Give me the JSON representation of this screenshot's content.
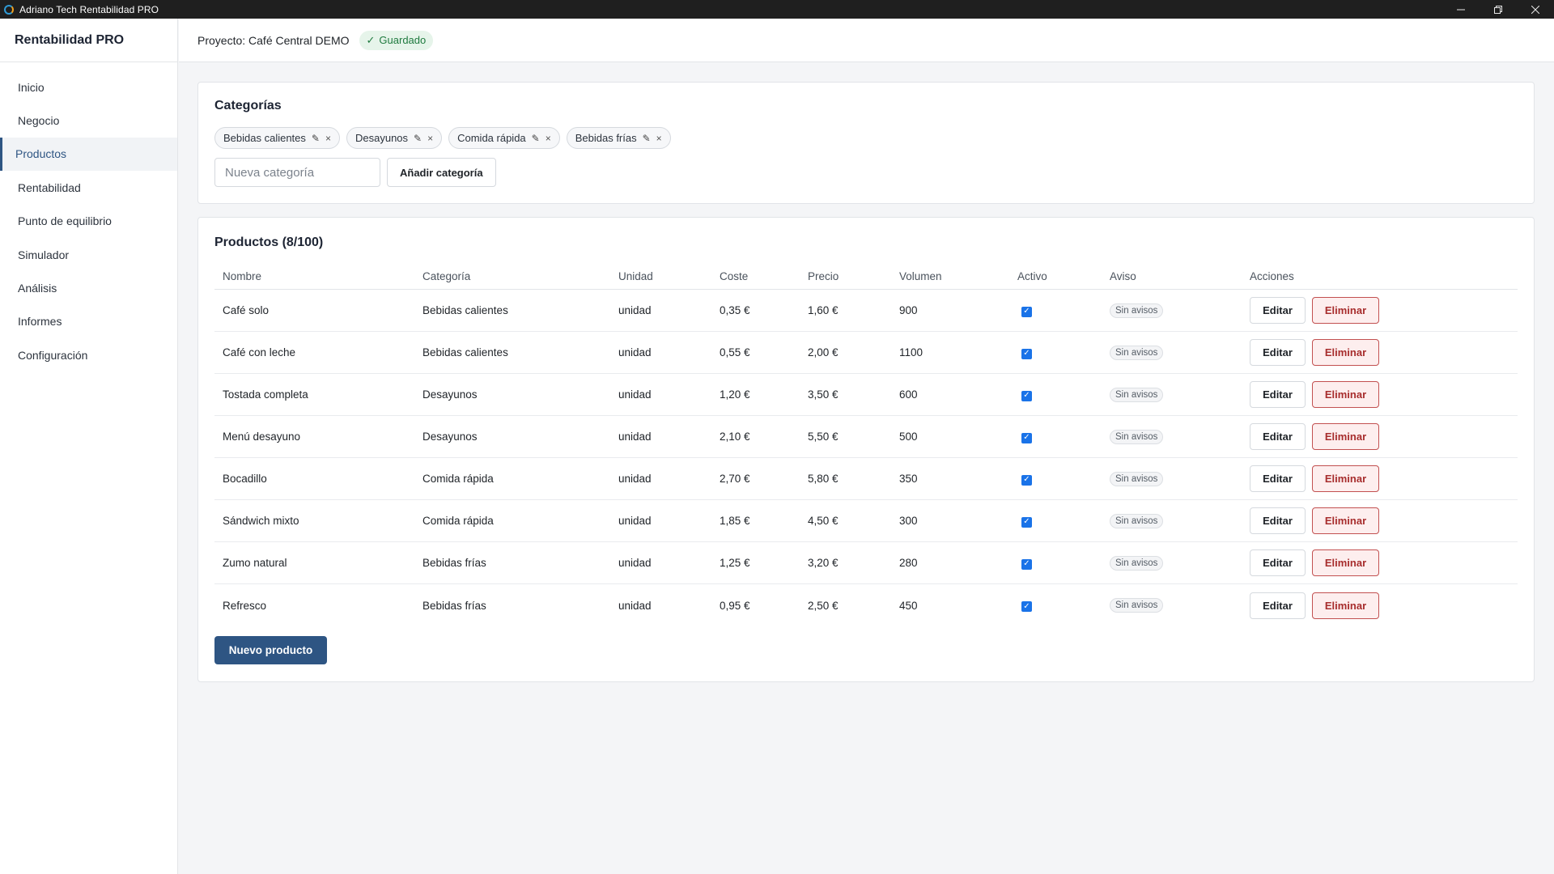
{
  "window": {
    "title": "Adriano Tech Rentabilidad PRO",
    "controls": [
      "minimize-icon",
      "restore-icon",
      "close-icon"
    ]
  },
  "sidebar": {
    "brand": "Rentabilidad PRO",
    "items": [
      {
        "label": "Inicio",
        "active": false
      },
      {
        "label": "Negocio",
        "active": false
      },
      {
        "label": "Productos",
        "active": true
      },
      {
        "label": "Rentabilidad",
        "active": false
      },
      {
        "label": "Punto de equilibrio",
        "active": false
      },
      {
        "label": "Simulador",
        "active": false
      },
      {
        "label": "Análisis",
        "active": false
      },
      {
        "label": "Informes",
        "active": false
      },
      {
        "label": "Configuración",
        "active": false
      }
    ]
  },
  "header": {
    "project": "Proyecto: Café Central DEMO",
    "saved_icon": "✓",
    "saved": "Guardado"
  },
  "categories": {
    "title": "Categorías",
    "chips": [
      "Bebidas calientes",
      "Desayunos",
      "Comida rápida",
      "Bebidas frías"
    ],
    "edit_icon": "✎",
    "remove_icon": "×",
    "new_placeholder": "Nueva categoría",
    "add_button": "Añadir categoría"
  },
  "products": {
    "title": "Productos (8/100)",
    "columns": [
      "Nombre",
      "Categoría",
      "Unidad",
      "Coste",
      "Precio",
      "Volumen",
      "Activo",
      "Aviso",
      "Acciones"
    ],
    "rows": [
      {
        "name": "Café solo",
        "category": "Bebidas calientes",
        "unit": "unidad",
        "cost": "0,35 €",
        "price": "1,60 €",
        "volume": "900",
        "active": true,
        "warning": "Sin avisos"
      },
      {
        "name": "Café con leche",
        "category": "Bebidas calientes",
        "unit": "unidad",
        "cost": "0,55 €",
        "price": "2,00 €",
        "volume": "1100",
        "active": true,
        "warning": "Sin avisos"
      },
      {
        "name": "Tostada completa",
        "category": "Desayunos",
        "unit": "unidad",
        "cost": "1,20 €",
        "price": "3,50 €",
        "volume": "600",
        "active": true,
        "warning": "Sin avisos"
      },
      {
        "name": "Menú desayuno",
        "category": "Desayunos",
        "unit": "unidad",
        "cost": "2,10 €",
        "price": "5,50 €",
        "volume": "500",
        "active": true,
        "warning": "Sin avisos"
      },
      {
        "name": "Bocadillo",
        "category": "Comida rápida",
        "unit": "unidad",
        "cost": "2,70 €",
        "price": "5,80 €",
        "volume": "350",
        "active": true,
        "warning": "Sin avisos"
      },
      {
        "name": "Sándwich mixto",
        "category": "Comida rápida",
        "unit": "unidad",
        "cost": "1,85 €",
        "price": "4,50 €",
        "volume": "300",
        "active": true,
        "warning": "Sin avisos"
      },
      {
        "name": "Zumo natural",
        "category": "Bebidas frías",
        "unit": "unidad",
        "cost": "1,25 €",
        "price": "3,20 €",
        "volume": "280",
        "active": true,
        "warning": "Sin avisos"
      },
      {
        "name": "Refresco",
        "category": "Bebidas frías",
        "unit": "unidad",
        "cost": "0,95 €",
        "price": "2,50 €",
        "volume": "450",
        "active": true,
        "warning": "Sin avisos"
      }
    ],
    "edit_label": "Editar",
    "delete_label": "Eliminar",
    "new_button": "Nuevo producto"
  },
  "colors": {
    "accent": "#2e5583",
    "danger": "#a72d2d",
    "success": "#1f7a3f",
    "checkbox": "#1a73e8"
  }
}
